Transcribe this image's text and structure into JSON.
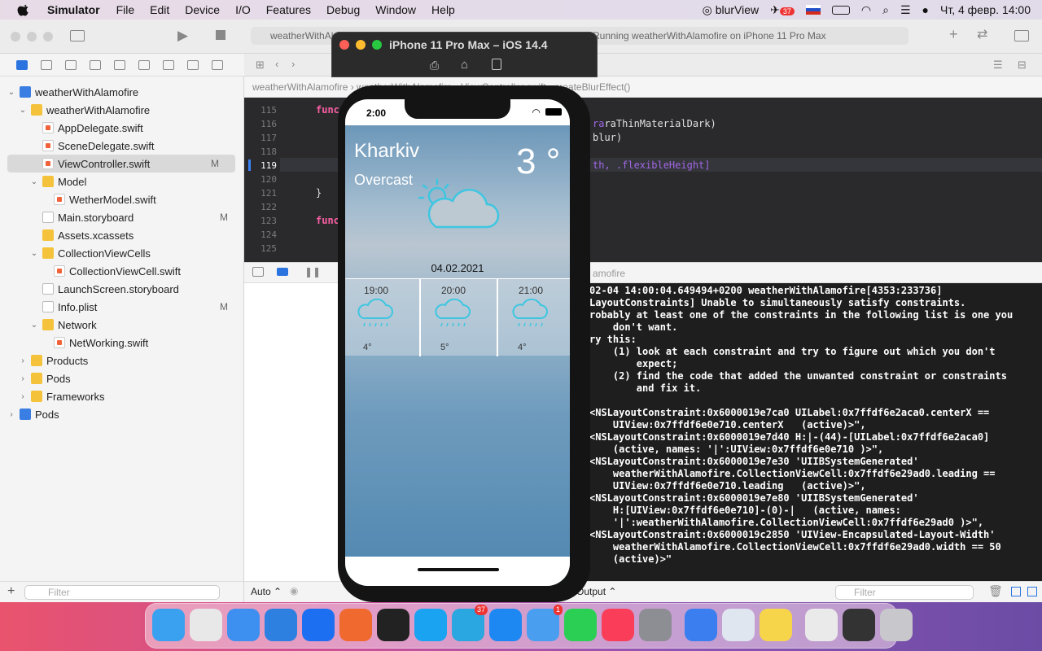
{
  "menubar": {
    "app_name": "Simulator",
    "items": [
      "File",
      "Edit",
      "Device",
      "I/O",
      "Features",
      "Debug",
      "Window",
      "Help"
    ],
    "right": {
      "app_label": "blurView",
      "telegram_badge": "37",
      "datetime": "Чт, 4 февр.  14:00"
    }
  },
  "navigator": {
    "rows": [
      {
        "label": "weatherWithAlamofire",
        "level": 0,
        "icon": "proj",
        "chev": "⌄",
        "mark": ""
      },
      {
        "label": "weatherWithAlamofire",
        "level": 1,
        "icon": "folder",
        "chev": "⌄",
        "mark": ""
      },
      {
        "label": "AppDelegate.swift",
        "level": 2,
        "icon": "swift",
        "chev": "",
        "mark": ""
      },
      {
        "label": "SceneDelegate.swift",
        "level": 2,
        "icon": "swift",
        "chev": "",
        "mark": ""
      },
      {
        "label": "ViewController.swift",
        "level": 2,
        "icon": "swift",
        "chev": "",
        "mark": "M",
        "selected": true
      },
      {
        "label": "Model",
        "level": 2,
        "icon": "folder",
        "chev": "⌄",
        "mark": ""
      },
      {
        "label": "WetherModel.swift",
        "level": 3,
        "icon": "swift",
        "chev": "",
        "mark": ""
      },
      {
        "label": "Main.storyboard",
        "level": 2,
        "icon": "file",
        "chev": "",
        "mark": "M"
      },
      {
        "label": "Assets.xcassets",
        "level": 2,
        "icon": "folder",
        "chev": "",
        "mark": ""
      },
      {
        "label": "CollectionViewCells",
        "level": 2,
        "icon": "folder",
        "chev": "⌄",
        "mark": ""
      },
      {
        "label": "CollectionViewCell.swift",
        "level": 3,
        "icon": "swift",
        "chev": "",
        "mark": ""
      },
      {
        "label": "LaunchScreen.storyboard",
        "level": 2,
        "icon": "file",
        "chev": "",
        "mark": ""
      },
      {
        "label": "Info.plist",
        "level": 2,
        "icon": "file",
        "chev": "",
        "mark": "M"
      },
      {
        "label": "Network",
        "level": 2,
        "icon": "folder",
        "chev": "⌄",
        "mark": ""
      },
      {
        "label": "NetWorking.swift",
        "level": 3,
        "icon": "swift",
        "chev": "",
        "mark": ""
      },
      {
        "label": "Products",
        "level": 1,
        "icon": "folder",
        "chev": "›",
        "mark": ""
      },
      {
        "label": "Pods",
        "level": 1,
        "icon": "folder",
        "chev": "›",
        "mark": ""
      },
      {
        "label": "Frameworks",
        "level": 1,
        "icon": "folder",
        "chev": "›",
        "mark": ""
      },
      {
        "label": "Pods",
        "level": 0,
        "icon": "proj",
        "chev": "›",
        "mark": ""
      }
    ],
    "filter_placeholder": "Filter"
  },
  "editor": {
    "activity": "Running weatherWithAlamofire on iPhone 11 Pro Max",
    "tab": "weatherWithAlamofire",
    "jumpbar": [
      "weatherWithAlamofire",
      "weatherWithAlamofire",
      "ViewController.swift",
      "createBlurEffect()"
    ],
    "line_numbers": [
      "115",
      "116",
      "117",
      "118",
      "119",
      "120",
      "121",
      "122",
      "123",
      "124",
      "125"
    ],
    "current_line": "119",
    "code": {
      "l115": "func",
      "l116": "raThinMaterialDark)",
      "l117": "blur)",
      "l119": "th, .flexibleHeight]",
      "l121": "}",
      "l123": "func"
    }
  },
  "debug": {
    "scheme_label": "amofire",
    "auto_label": "Auto ⌃",
    "output_label": "Output ⌃",
    "filter_placeholder": "Filter",
    "console": "02-04 14:00:04.649494+0200 weatherWithAlamofire[4353:233736]\nLayoutConstraints] Unable to simultaneously satisfy constraints.\nrobably at least one of the constraints in the following list is one you\n    don't want.\nry this:\n    (1) look at each constraint and try to figure out which you don't\n        expect;\n    (2) find the code that added the unwanted constraint or constraints\n        and fix it.\n\n<NSLayoutConstraint:0x6000019e7ca0 UILabel:0x7ffdf6e2aca0.centerX ==\n    UIView:0x7ffdf6e0e710.centerX   (active)>\",\n<NSLayoutConstraint:0x6000019e7d40 H:|-(44)-[UILabel:0x7ffdf6e2aca0]\n    (active, names: '|':UIView:0x7ffdf6e0e710 )>\",\n<NSLayoutConstraint:0x6000019e7e30 'UIIBSystemGenerated'\n    weatherWithAlamofire.CollectionViewCell:0x7ffdf6e29ad0.leading ==\n    UIView:0x7ffdf6e0e710.leading   (active)>\",\n<NSLayoutConstraint:0x6000019e7e80 'UIIBSystemGenerated'\n    H:[UIView:0x7ffdf6e0e710]-(0)-|   (active, names:\n    '|':weatherWithAlamofire.CollectionViewCell:0x7ffdf6e29ad0 )>\",\n<NSLayoutConstraint:0x6000019c2850 'UIView-Encapsulated-Layout-Width'\n    weatherWithAlamofire.CollectionViewCell:0x7ffdf6e29ad0.width == 50\n    (active)>\""
  },
  "simulator": {
    "title": "iPhone 11 Pro Max – iOS 14.4",
    "time": "2:00",
    "city": "Kharkiv",
    "condition": "Overcast",
    "temperature": "3 °",
    "date": "04.02.2021",
    "hours": [
      {
        "time": "19:00",
        "temp": "4°"
      },
      {
        "time": "20:00",
        "temp": "5°"
      },
      {
        "time": "21:00",
        "temp": "4°"
      }
    ]
  },
  "dock": {
    "apps": [
      "finder-icon",
      "launchpad-icon",
      "safari-icon",
      "xcode-icon",
      "maps-pin-icon",
      "pencil-app-icon",
      "terminal-icon",
      "skype-icon",
      "telegram-icon",
      "app-store-icon",
      "mail-icon",
      "facetime-icon",
      "music-icon",
      "system-preferences-icon",
      "simulator-icon",
      "preview-icon",
      "notes-icon",
      "window-thumb-icon",
      "window-thumb2-icon",
      "trash-icon"
    ],
    "telegram_badge": "37",
    "mail_badge": "1"
  }
}
